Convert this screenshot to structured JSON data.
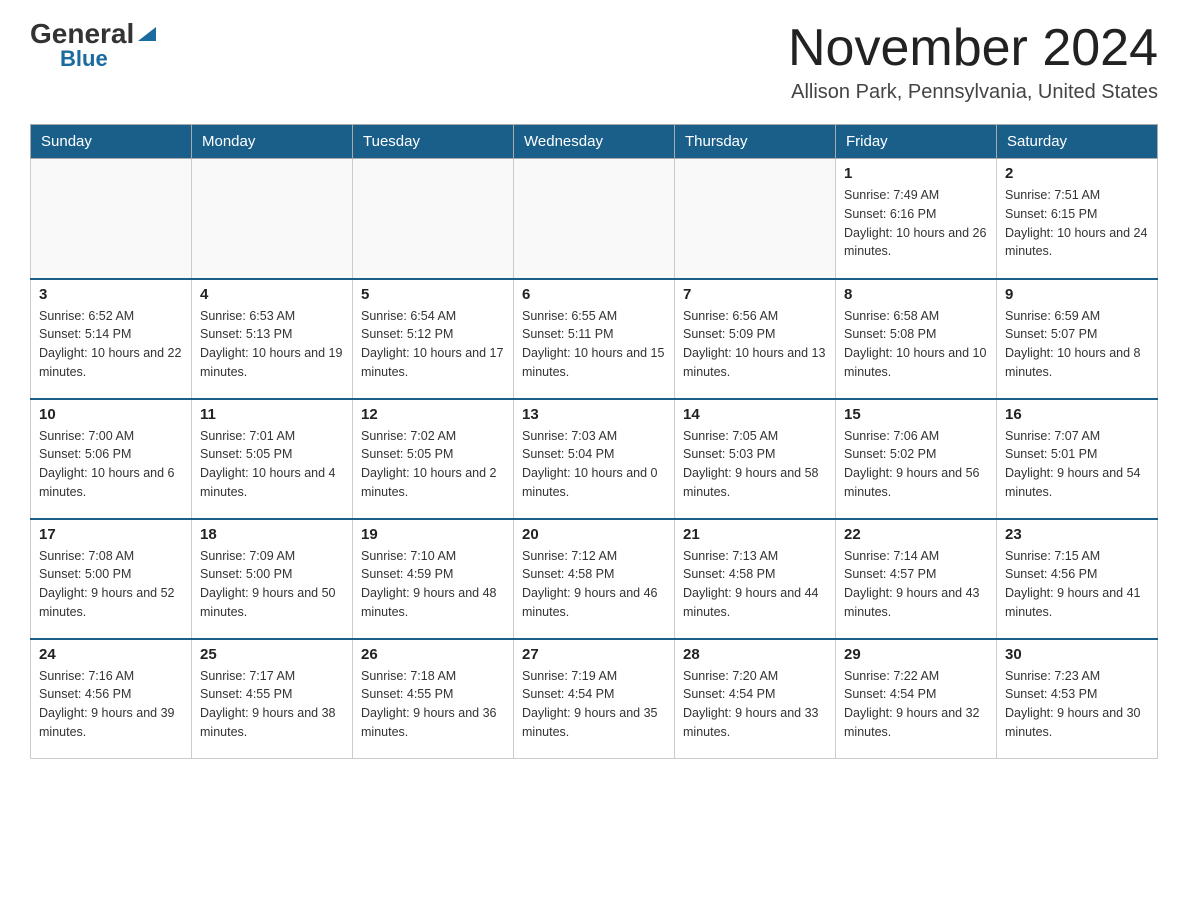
{
  "logo": {
    "general": "General",
    "blue": "Blue",
    "triangle": "▲"
  },
  "header": {
    "title": "November 2024",
    "location": "Allison Park, Pennsylvania, United States"
  },
  "weekdays": [
    "Sunday",
    "Monday",
    "Tuesday",
    "Wednesday",
    "Thursday",
    "Friday",
    "Saturday"
  ],
  "weeks": [
    [
      {
        "day": "",
        "sunrise": "",
        "sunset": "",
        "daylight": ""
      },
      {
        "day": "",
        "sunrise": "",
        "sunset": "",
        "daylight": ""
      },
      {
        "day": "",
        "sunrise": "",
        "sunset": "",
        "daylight": ""
      },
      {
        "day": "",
        "sunrise": "",
        "sunset": "",
        "daylight": ""
      },
      {
        "day": "",
        "sunrise": "",
        "sunset": "",
        "daylight": ""
      },
      {
        "day": "1",
        "sunrise": "Sunrise: 7:49 AM",
        "sunset": "Sunset: 6:16 PM",
        "daylight": "Daylight: 10 hours and 26 minutes."
      },
      {
        "day": "2",
        "sunrise": "Sunrise: 7:51 AM",
        "sunset": "Sunset: 6:15 PM",
        "daylight": "Daylight: 10 hours and 24 minutes."
      }
    ],
    [
      {
        "day": "3",
        "sunrise": "Sunrise: 6:52 AM",
        "sunset": "Sunset: 5:14 PM",
        "daylight": "Daylight: 10 hours and 22 minutes."
      },
      {
        "day": "4",
        "sunrise": "Sunrise: 6:53 AM",
        "sunset": "Sunset: 5:13 PM",
        "daylight": "Daylight: 10 hours and 19 minutes."
      },
      {
        "day": "5",
        "sunrise": "Sunrise: 6:54 AM",
        "sunset": "Sunset: 5:12 PM",
        "daylight": "Daylight: 10 hours and 17 minutes."
      },
      {
        "day": "6",
        "sunrise": "Sunrise: 6:55 AM",
        "sunset": "Sunset: 5:11 PM",
        "daylight": "Daylight: 10 hours and 15 minutes."
      },
      {
        "day": "7",
        "sunrise": "Sunrise: 6:56 AM",
        "sunset": "Sunset: 5:09 PM",
        "daylight": "Daylight: 10 hours and 13 minutes."
      },
      {
        "day": "8",
        "sunrise": "Sunrise: 6:58 AM",
        "sunset": "Sunset: 5:08 PM",
        "daylight": "Daylight: 10 hours and 10 minutes."
      },
      {
        "day": "9",
        "sunrise": "Sunrise: 6:59 AM",
        "sunset": "Sunset: 5:07 PM",
        "daylight": "Daylight: 10 hours and 8 minutes."
      }
    ],
    [
      {
        "day": "10",
        "sunrise": "Sunrise: 7:00 AM",
        "sunset": "Sunset: 5:06 PM",
        "daylight": "Daylight: 10 hours and 6 minutes."
      },
      {
        "day": "11",
        "sunrise": "Sunrise: 7:01 AM",
        "sunset": "Sunset: 5:05 PM",
        "daylight": "Daylight: 10 hours and 4 minutes."
      },
      {
        "day": "12",
        "sunrise": "Sunrise: 7:02 AM",
        "sunset": "Sunset: 5:05 PM",
        "daylight": "Daylight: 10 hours and 2 minutes."
      },
      {
        "day": "13",
        "sunrise": "Sunrise: 7:03 AM",
        "sunset": "Sunset: 5:04 PM",
        "daylight": "Daylight: 10 hours and 0 minutes."
      },
      {
        "day": "14",
        "sunrise": "Sunrise: 7:05 AM",
        "sunset": "Sunset: 5:03 PM",
        "daylight": "Daylight: 9 hours and 58 minutes."
      },
      {
        "day": "15",
        "sunrise": "Sunrise: 7:06 AM",
        "sunset": "Sunset: 5:02 PM",
        "daylight": "Daylight: 9 hours and 56 minutes."
      },
      {
        "day": "16",
        "sunrise": "Sunrise: 7:07 AM",
        "sunset": "Sunset: 5:01 PM",
        "daylight": "Daylight: 9 hours and 54 minutes."
      }
    ],
    [
      {
        "day": "17",
        "sunrise": "Sunrise: 7:08 AM",
        "sunset": "Sunset: 5:00 PM",
        "daylight": "Daylight: 9 hours and 52 minutes."
      },
      {
        "day": "18",
        "sunrise": "Sunrise: 7:09 AM",
        "sunset": "Sunset: 5:00 PM",
        "daylight": "Daylight: 9 hours and 50 minutes."
      },
      {
        "day": "19",
        "sunrise": "Sunrise: 7:10 AM",
        "sunset": "Sunset: 4:59 PM",
        "daylight": "Daylight: 9 hours and 48 minutes."
      },
      {
        "day": "20",
        "sunrise": "Sunrise: 7:12 AM",
        "sunset": "Sunset: 4:58 PM",
        "daylight": "Daylight: 9 hours and 46 minutes."
      },
      {
        "day": "21",
        "sunrise": "Sunrise: 7:13 AM",
        "sunset": "Sunset: 4:58 PM",
        "daylight": "Daylight: 9 hours and 44 minutes."
      },
      {
        "day": "22",
        "sunrise": "Sunrise: 7:14 AM",
        "sunset": "Sunset: 4:57 PM",
        "daylight": "Daylight: 9 hours and 43 minutes."
      },
      {
        "day": "23",
        "sunrise": "Sunrise: 7:15 AM",
        "sunset": "Sunset: 4:56 PM",
        "daylight": "Daylight: 9 hours and 41 minutes."
      }
    ],
    [
      {
        "day": "24",
        "sunrise": "Sunrise: 7:16 AM",
        "sunset": "Sunset: 4:56 PM",
        "daylight": "Daylight: 9 hours and 39 minutes."
      },
      {
        "day": "25",
        "sunrise": "Sunrise: 7:17 AM",
        "sunset": "Sunset: 4:55 PM",
        "daylight": "Daylight: 9 hours and 38 minutes."
      },
      {
        "day": "26",
        "sunrise": "Sunrise: 7:18 AM",
        "sunset": "Sunset: 4:55 PM",
        "daylight": "Daylight: 9 hours and 36 minutes."
      },
      {
        "day": "27",
        "sunrise": "Sunrise: 7:19 AM",
        "sunset": "Sunset: 4:54 PM",
        "daylight": "Daylight: 9 hours and 35 minutes."
      },
      {
        "day": "28",
        "sunrise": "Sunrise: 7:20 AM",
        "sunset": "Sunset: 4:54 PM",
        "daylight": "Daylight: 9 hours and 33 minutes."
      },
      {
        "day": "29",
        "sunrise": "Sunrise: 7:22 AM",
        "sunset": "Sunset: 4:54 PM",
        "daylight": "Daylight: 9 hours and 32 minutes."
      },
      {
        "day": "30",
        "sunrise": "Sunrise: 7:23 AM",
        "sunset": "Sunset: 4:53 PM",
        "daylight": "Daylight: 9 hours and 30 minutes."
      }
    ]
  ]
}
